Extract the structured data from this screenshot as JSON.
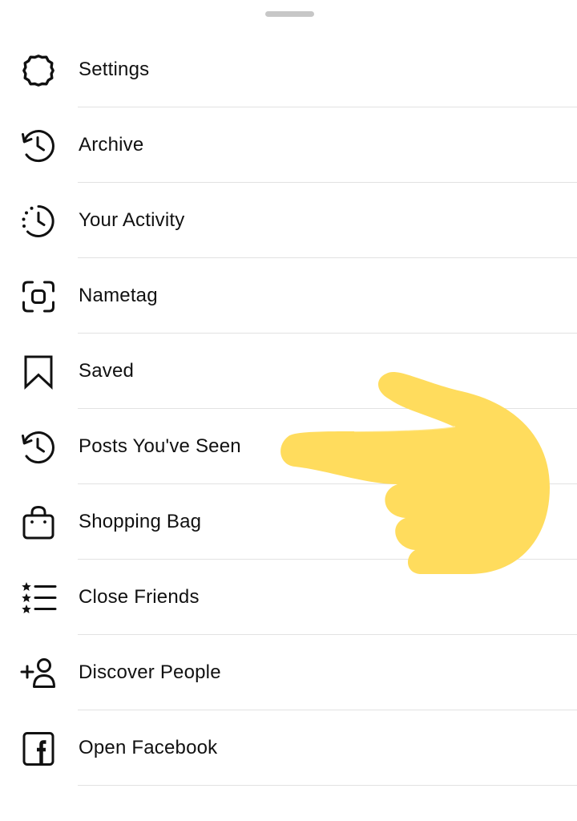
{
  "menu": {
    "items": [
      {
        "label": "Settings",
        "icon": "gear-icon"
      },
      {
        "label": "Archive",
        "icon": "archive-history-icon"
      },
      {
        "label": "Your Activity",
        "icon": "activity-clock-icon"
      },
      {
        "label": "Nametag",
        "icon": "nametag-scan-icon"
      },
      {
        "label": "Saved",
        "icon": "bookmark-icon"
      },
      {
        "label": "Posts You've Seen",
        "icon": "history-icon"
      },
      {
        "label": "Shopping Bag",
        "icon": "shopping-bag-icon"
      },
      {
        "label": "Close Friends",
        "icon": "star-list-icon"
      },
      {
        "label": "Discover People",
        "icon": "add-person-icon"
      },
      {
        "label": "Open Facebook",
        "icon": "facebook-icon"
      }
    ]
  },
  "overlay": {
    "icon": "pointing-hand-emoji",
    "color": "#FFDC5D"
  },
  "colors": {
    "background": "#FFFFFF",
    "text": "#111111",
    "divider": "#E2E2E2",
    "handle": "#C7C7C7"
  }
}
